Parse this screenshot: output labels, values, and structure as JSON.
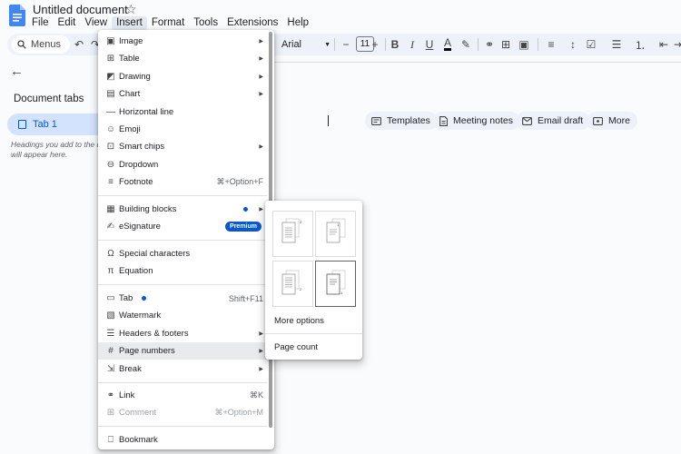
{
  "app": {
    "doc_title": "Untitled document",
    "menus": [
      "File",
      "Edit",
      "View",
      "Insert",
      "Format",
      "Tools",
      "Extensions",
      "Help"
    ],
    "active_menu": "Insert"
  },
  "toolbar": {
    "search_label": "Menus",
    "font_name": "Arial",
    "font_size": "11"
  },
  "sidebar": {
    "section_label": "Document tabs",
    "tab_label": "Tab 1",
    "hint": "Headings you add to the do",
    "hint2": "will appear here."
  },
  "chips": [
    "Templates",
    "Meeting notes",
    "Email draft",
    "More"
  ],
  "insert_menu": {
    "items": [
      {
        "label": "Image",
        "icon": "image-icon",
        "submenu": true
      },
      {
        "label": "Table",
        "icon": "table-icon",
        "submenu": true
      },
      {
        "label": "Drawing",
        "icon": "drawing-icon",
        "submenu": true
      },
      {
        "label": "Chart",
        "icon": "chart-icon",
        "submenu": true
      },
      {
        "label": "Horizontal line",
        "icon": "horizontal-line-icon"
      },
      {
        "label": "Emoji",
        "icon": "emoji-icon"
      },
      {
        "label": "Smart chips",
        "icon": "smart-chips-icon",
        "submenu": true
      },
      {
        "label": "Dropdown",
        "icon": "dropdown-icon"
      },
      {
        "label": "Footnote",
        "icon": "footnote-icon",
        "shortcut": "⌘+Option+F"
      },
      {
        "label": "Building blocks",
        "icon": "building-blocks-icon",
        "submenu": true,
        "dot": true
      },
      {
        "label": "eSignature",
        "icon": "esignature-icon",
        "badge": "Premium"
      },
      {
        "label": "Special characters",
        "icon": "omega-icon"
      },
      {
        "label": "Equation",
        "icon": "pi-icon"
      },
      {
        "label": "Tab",
        "icon": "tab-icon",
        "shortcut": "Shift+F11",
        "dot": true
      },
      {
        "label": "Watermark",
        "icon": "watermark-icon"
      },
      {
        "label": "Headers & footers",
        "icon": "headers-footers-icon",
        "submenu": true
      },
      {
        "label": "Page numbers",
        "icon": "hash-icon",
        "submenu": true
      },
      {
        "label": "Break",
        "icon": "break-icon",
        "submenu": true
      },
      {
        "label": "Link",
        "icon": "link-icon",
        "shortcut": "⌘K"
      },
      {
        "label": "Comment",
        "icon": "comment-icon",
        "shortcut": "⌘+Option+M",
        "disabled": true
      },
      {
        "label": "Bookmark",
        "icon": "bookmark-icon"
      }
    ]
  },
  "page_numbers_submenu": {
    "more_options": "More options",
    "page_count": "Page count",
    "thumb_numbers": [
      "2",
      "1",
      "2",
      "1"
    ]
  },
  "colors": {
    "accent": "#0b57d0",
    "menu_hover": "#e9eaed",
    "toolbar_bg": "#edf2fa"
  }
}
